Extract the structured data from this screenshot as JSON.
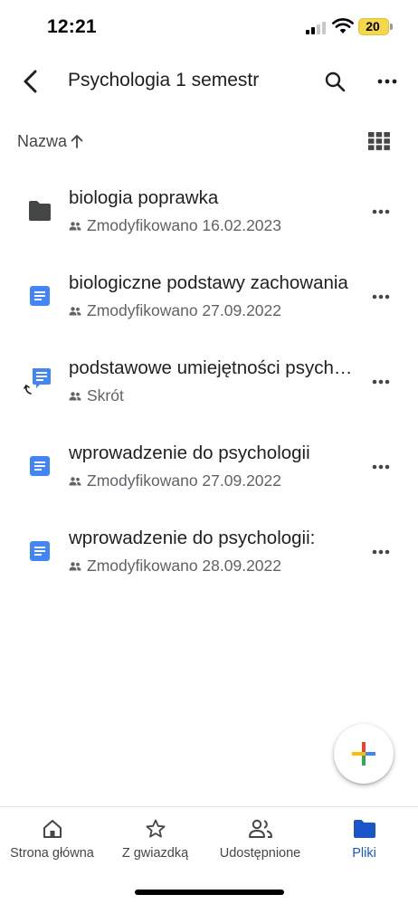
{
  "status_bar": {
    "time": "12:21",
    "battery_level": "20",
    "battery_color": "#f5d84a"
  },
  "header": {
    "title": "Psychologia 1 semestr",
    "back_icon": "chevron-left-icon",
    "search_icon": "search-icon",
    "more_icon": "more-horizontal-icon"
  },
  "sort": {
    "label": "Nazwa",
    "direction_icon": "arrow-up-icon",
    "view_icon": "grid-view-icon"
  },
  "files": [
    {
      "name": "biologia poprawka",
      "type": "folder",
      "meta": "Zmodyfikowano 16.02.2023",
      "shared": true
    },
    {
      "name": "biologiczne podstawy zachowania",
      "type": "document",
      "meta": "Zmodyfikowano 27.09.2022",
      "shared": true
    },
    {
      "name": "podstawowe umiejętności psychologa",
      "type": "shortcut-document",
      "meta": "Skrót",
      "shared": true
    },
    {
      "name": "wprowadzenie do psychologii",
      "type": "document",
      "meta": "Zmodyfikowano 27.09.2022",
      "shared": true
    },
    {
      "name": "wprowadzenie do psychologii:",
      "type": "document",
      "meta": "Zmodyfikowano 28.09.2022",
      "shared": true
    }
  ],
  "fab": {
    "icon": "plus-icon",
    "colors": [
      "#ea4335",
      "#fbbc04",
      "#34a853",
      "#4285f4"
    ]
  },
  "bottom_nav": [
    {
      "label": "Strona główna",
      "icon": "home-icon",
      "active": false
    },
    {
      "label": "Z gwiazdką",
      "icon": "star-icon",
      "active": false
    },
    {
      "label": "Udostępnione",
      "icon": "people-icon",
      "active": false
    },
    {
      "label": "Pliki",
      "icon": "folder-icon",
      "active": true
    }
  ],
  "colors": {
    "accent": "#1a56c9",
    "doc_blue": "#4285f4",
    "folder_gray": "#444746",
    "text_primary": "#1f1f1f",
    "text_secondary": "#5f6368"
  }
}
